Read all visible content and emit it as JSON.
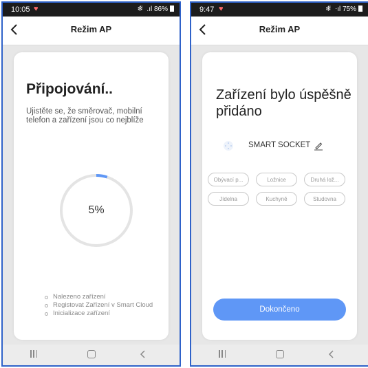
{
  "screens": [
    {
      "status": {
        "time": "10:05",
        "right": "❄̈  .ıl 86%"
      },
      "title": "Režim AP",
      "heading": "Připojování..",
      "description": "Ujistěte se, že směrovač, mobilní telefon a zařízení jsou co nejblíže",
      "progress": {
        "label": "5%",
        "fraction": 0.05
      },
      "steps": [
        "Nalezeno zařízení",
        "Registovat Zařízení v Smart Cloud",
        "Inicializace zařízení"
      ]
    },
    {
      "status": {
        "time": "9:47",
        "right": "❄̈  ⋅ıl 75%"
      },
      "title": "Režim AP",
      "heading": "Zařízení bylo úspěšně přidáno",
      "device_name": "SMART SOCKET",
      "rooms": [
        "Obývací p...",
        "Ložnice",
        "Druhá lož...",
        "Jídelna",
        "Kuchyně",
        "Studovna"
      ],
      "done_label": "Dokončeno"
    }
  ],
  "colors": {
    "accent": "#5f97f6",
    "status_heart": "#ff6a6a",
    "frame": "#2f62c9"
  },
  "icons": {
    "back": "chevron-left-icon",
    "status": "heart-icon",
    "edit": "pencil-icon",
    "device": "device-icon"
  }
}
